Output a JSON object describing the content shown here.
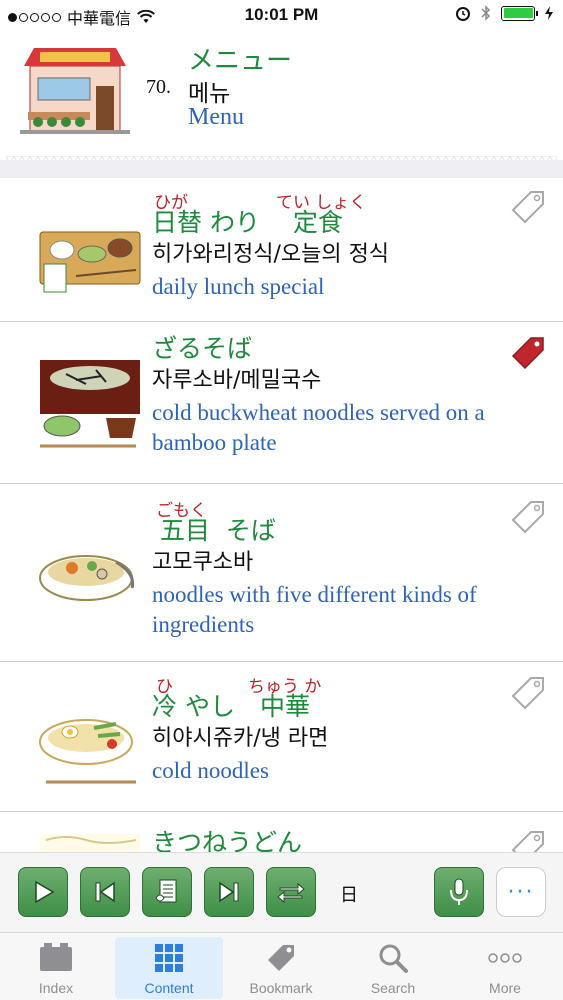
{
  "status_bar": {
    "carrier": "中華電信",
    "time": "10:01 PM"
  },
  "header": {
    "number": "70.",
    "title_jp": "メニュー",
    "title_ko": "메뉴",
    "title_en": "Menu"
  },
  "items": [
    {
      "ruby": [
        "ひが",
        "てい しょく"
      ],
      "jp": "日替 わり　 定食",
      "ko": "히가와리정식/오늘의 정식",
      "en": [
        "daily lunch special"
      ],
      "bookmarked": false
    },
    {
      "ruby": [],
      "jp": "ざるそば",
      "ko": "자루소바/메밀국수",
      "en": [
        "cold buckwheat noodles served on a",
        "bamboo plate"
      ],
      "bookmarked": true
    },
    {
      "ruby": [
        "ごもく"
      ],
      "jp": " 五目  そば",
      "ko": "고모쿠소바",
      "en": [
        "noodles with five different kinds of",
        "ingredients"
      ],
      "bookmarked": false
    },
    {
      "ruby": [
        "ひ",
        "ちゅう か"
      ],
      "jp": "冷 やし　中華",
      "ko": "히야시쥬카/냉 라면",
      "en": [
        "cold noodles"
      ],
      "bookmarked": false
    },
    {
      "ruby": [],
      "jp": "きつねうどん",
      "ko": "",
      "en": [],
      "bookmarked": false
    }
  ],
  "toolbar": {
    "day_label": "日",
    "more_label": "···"
  },
  "tabs": [
    {
      "label": "Index",
      "icon": "index-icon",
      "active": false
    },
    {
      "label": "Content",
      "icon": "content-grid-icon",
      "active": true
    },
    {
      "label": "Bookmark",
      "icon": "bookmark-tag-icon",
      "active": false
    },
    {
      "label": "Search",
      "icon": "search-icon",
      "active": false
    },
    {
      "label": "More",
      "icon": "more-dots-icon",
      "active": false
    }
  ],
  "colors": {
    "japanese": "#1f8a3c",
    "ruby": "#b8242a",
    "english": "#2e63b5",
    "tab_active": "#2e7ee0",
    "bookmark_active": "#c0272d",
    "button_green": "#4f9a55"
  }
}
